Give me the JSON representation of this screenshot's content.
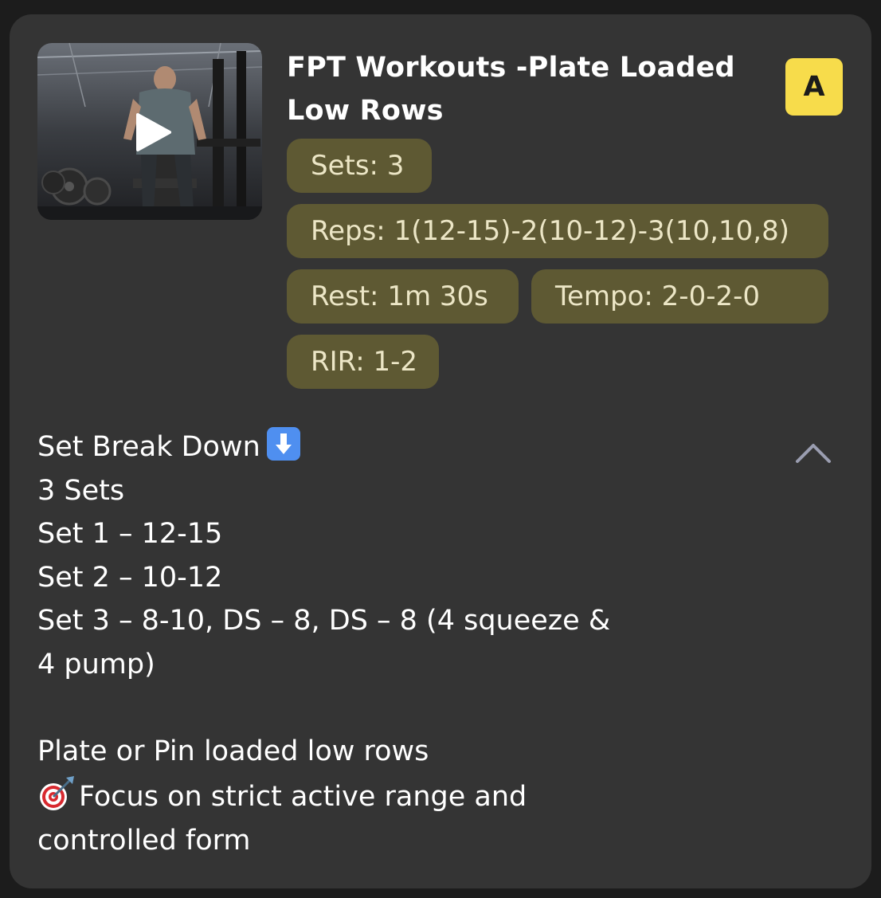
{
  "workout": {
    "title": "FPT Workouts -Plate Loaded Low Rows",
    "badge": "A",
    "chips": {
      "sets": "Sets: 3",
      "reps": "Reps: 1(12-15)-2(10-12)-3(10,10,8)",
      "rest": "Rest: 1m 30s",
      "tempo": "Tempo: 2-0-2-0",
      "rir": "RIR: 1-2"
    },
    "description": {
      "heading": "Set Break Down",
      "lines": [
        "3 Sets",
        "Set 1 – 12-15",
        "Set 2 – 10-12",
        "Set 3 – 8-10, DS – 8, DS – 8 (4 squeeze &",
        "4 pump)"
      ],
      "note_line1": "Plate or Pin loaded low rows",
      "note_line2": "Focus on strict active range and",
      "note_line3": "controlled form"
    },
    "icons": {
      "thumbnail_play": "play-icon",
      "heading_emoji": "down-arrow-icon",
      "note_emoji": "target-dart-icon",
      "toggle": "chevron-up-icon"
    },
    "colors": {
      "card_bg": "#343434",
      "chip_bg": "#5e5933",
      "chip_text": "#ece6c6",
      "badge_bg": "#f7dc4b"
    }
  }
}
